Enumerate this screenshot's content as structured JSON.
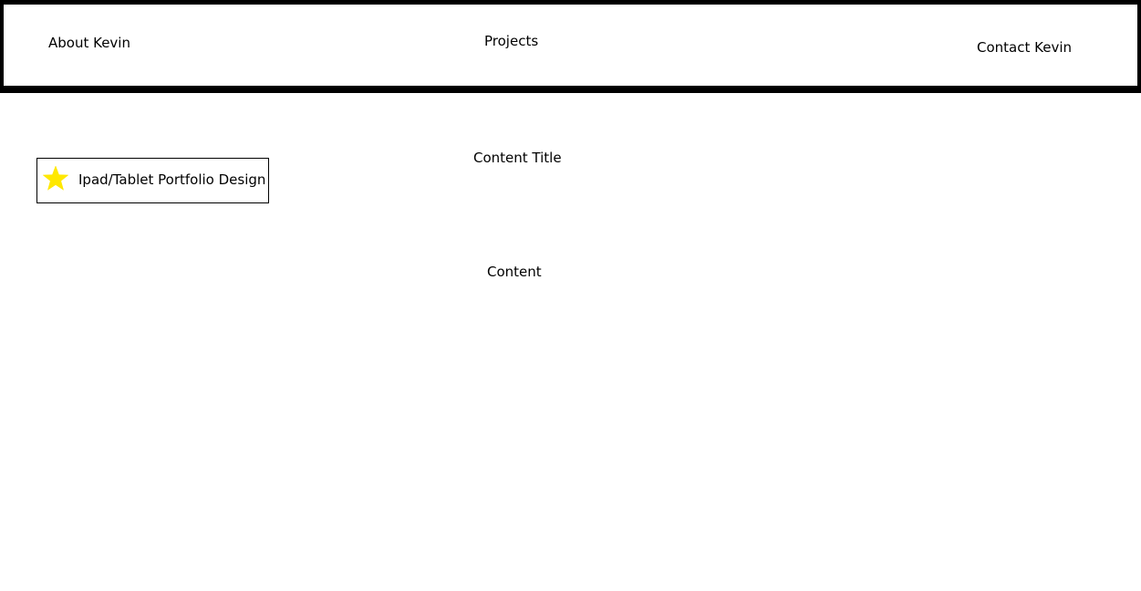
{
  "header": {
    "nav": {
      "about": "About Kevin",
      "projects": "Projects",
      "contact": "Contact Kevin"
    }
  },
  "sidebar": {
    "card": {
      "icon": "star-icon",
      "icon_color": "#FFE800",
      "label": "Ipad/Tablet Portfolio Design"
    }
  },
  "main": {
    "title": "Content Title",
    "body": "Content"
  }
}
